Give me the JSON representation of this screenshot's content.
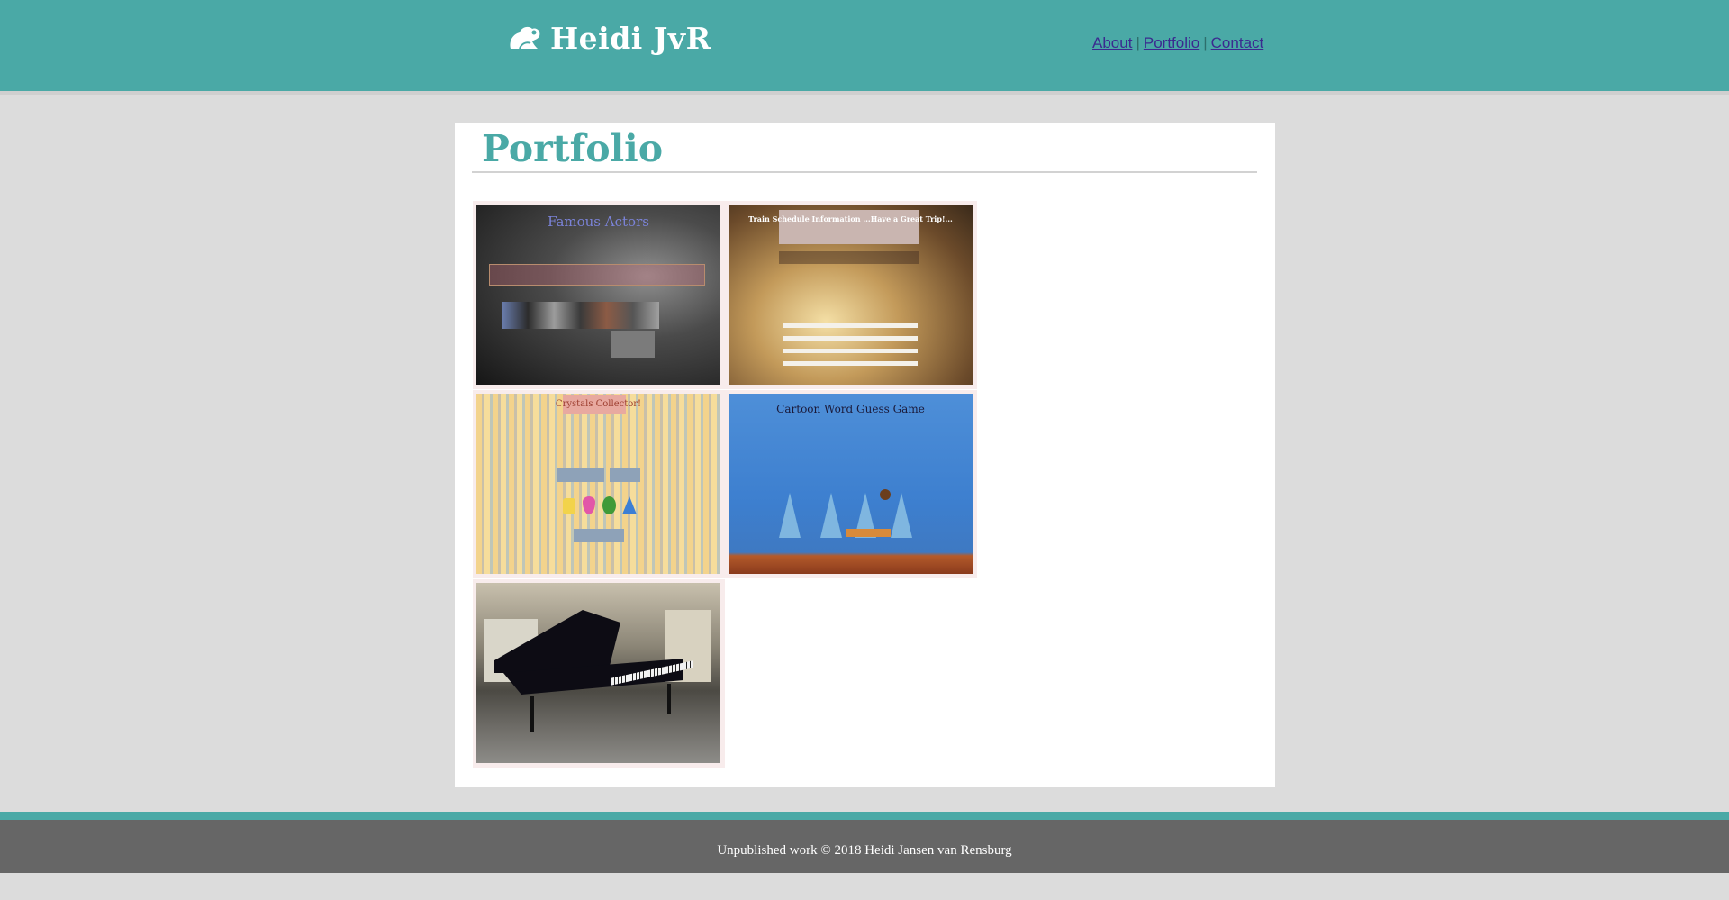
{
  "header": {
    "logo_text": "Heidi JvR",
    "logo_icon": "frog-icon",
    "nav": [
      {
        "label": "About"
      },
      {
        "label": "Portfolio"
      },
      {
        "label": "Contact"
      }
    ],
    "nav_separator": "|"
  },
  "main": {
    "title": "Portfolio",
    "projects": [
      {
        "name": "Famous Actors",
        "image_title": "Famous Actors"
      },
      {
        "name": "Train Schedule Information",
        "image_title": "Train Schedule Information ...Have a Great Trip!..."
      },
      {
        "name": "Crystals Collector",
        "image_title": "Crystals Collector!"
      },
      {
        "name": "Cartoon Word Guess Game",
        "image_title": "Cartoon Word Guess Game"
      },
      {
        "name": "Piano"
      }
    ]
  },
  "footer": {
    "text": "Unpublished work © 2018 Heidi Jansen van Rensburg"
  },
  "colors": {
    "teal": "#4aa9a6",
    "background": "#dcdcdc",
    "footer": "#666666",
    "link": "#3b2a8f"
  }
}
